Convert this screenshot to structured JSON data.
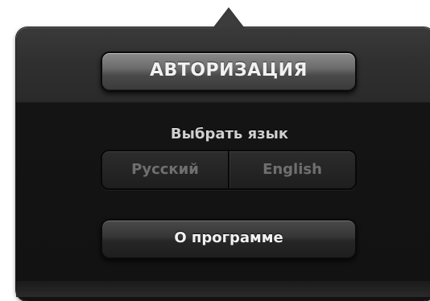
{
  "popover": {
    "auth_button_label": "АВТОРИЗАЦИЯ",
    "language": {
      "title": "Выбрать язык",
      "options": [
        "Русский",
        "English"
      ]
    },
    "about_button_label": "О программе"
  }
}
